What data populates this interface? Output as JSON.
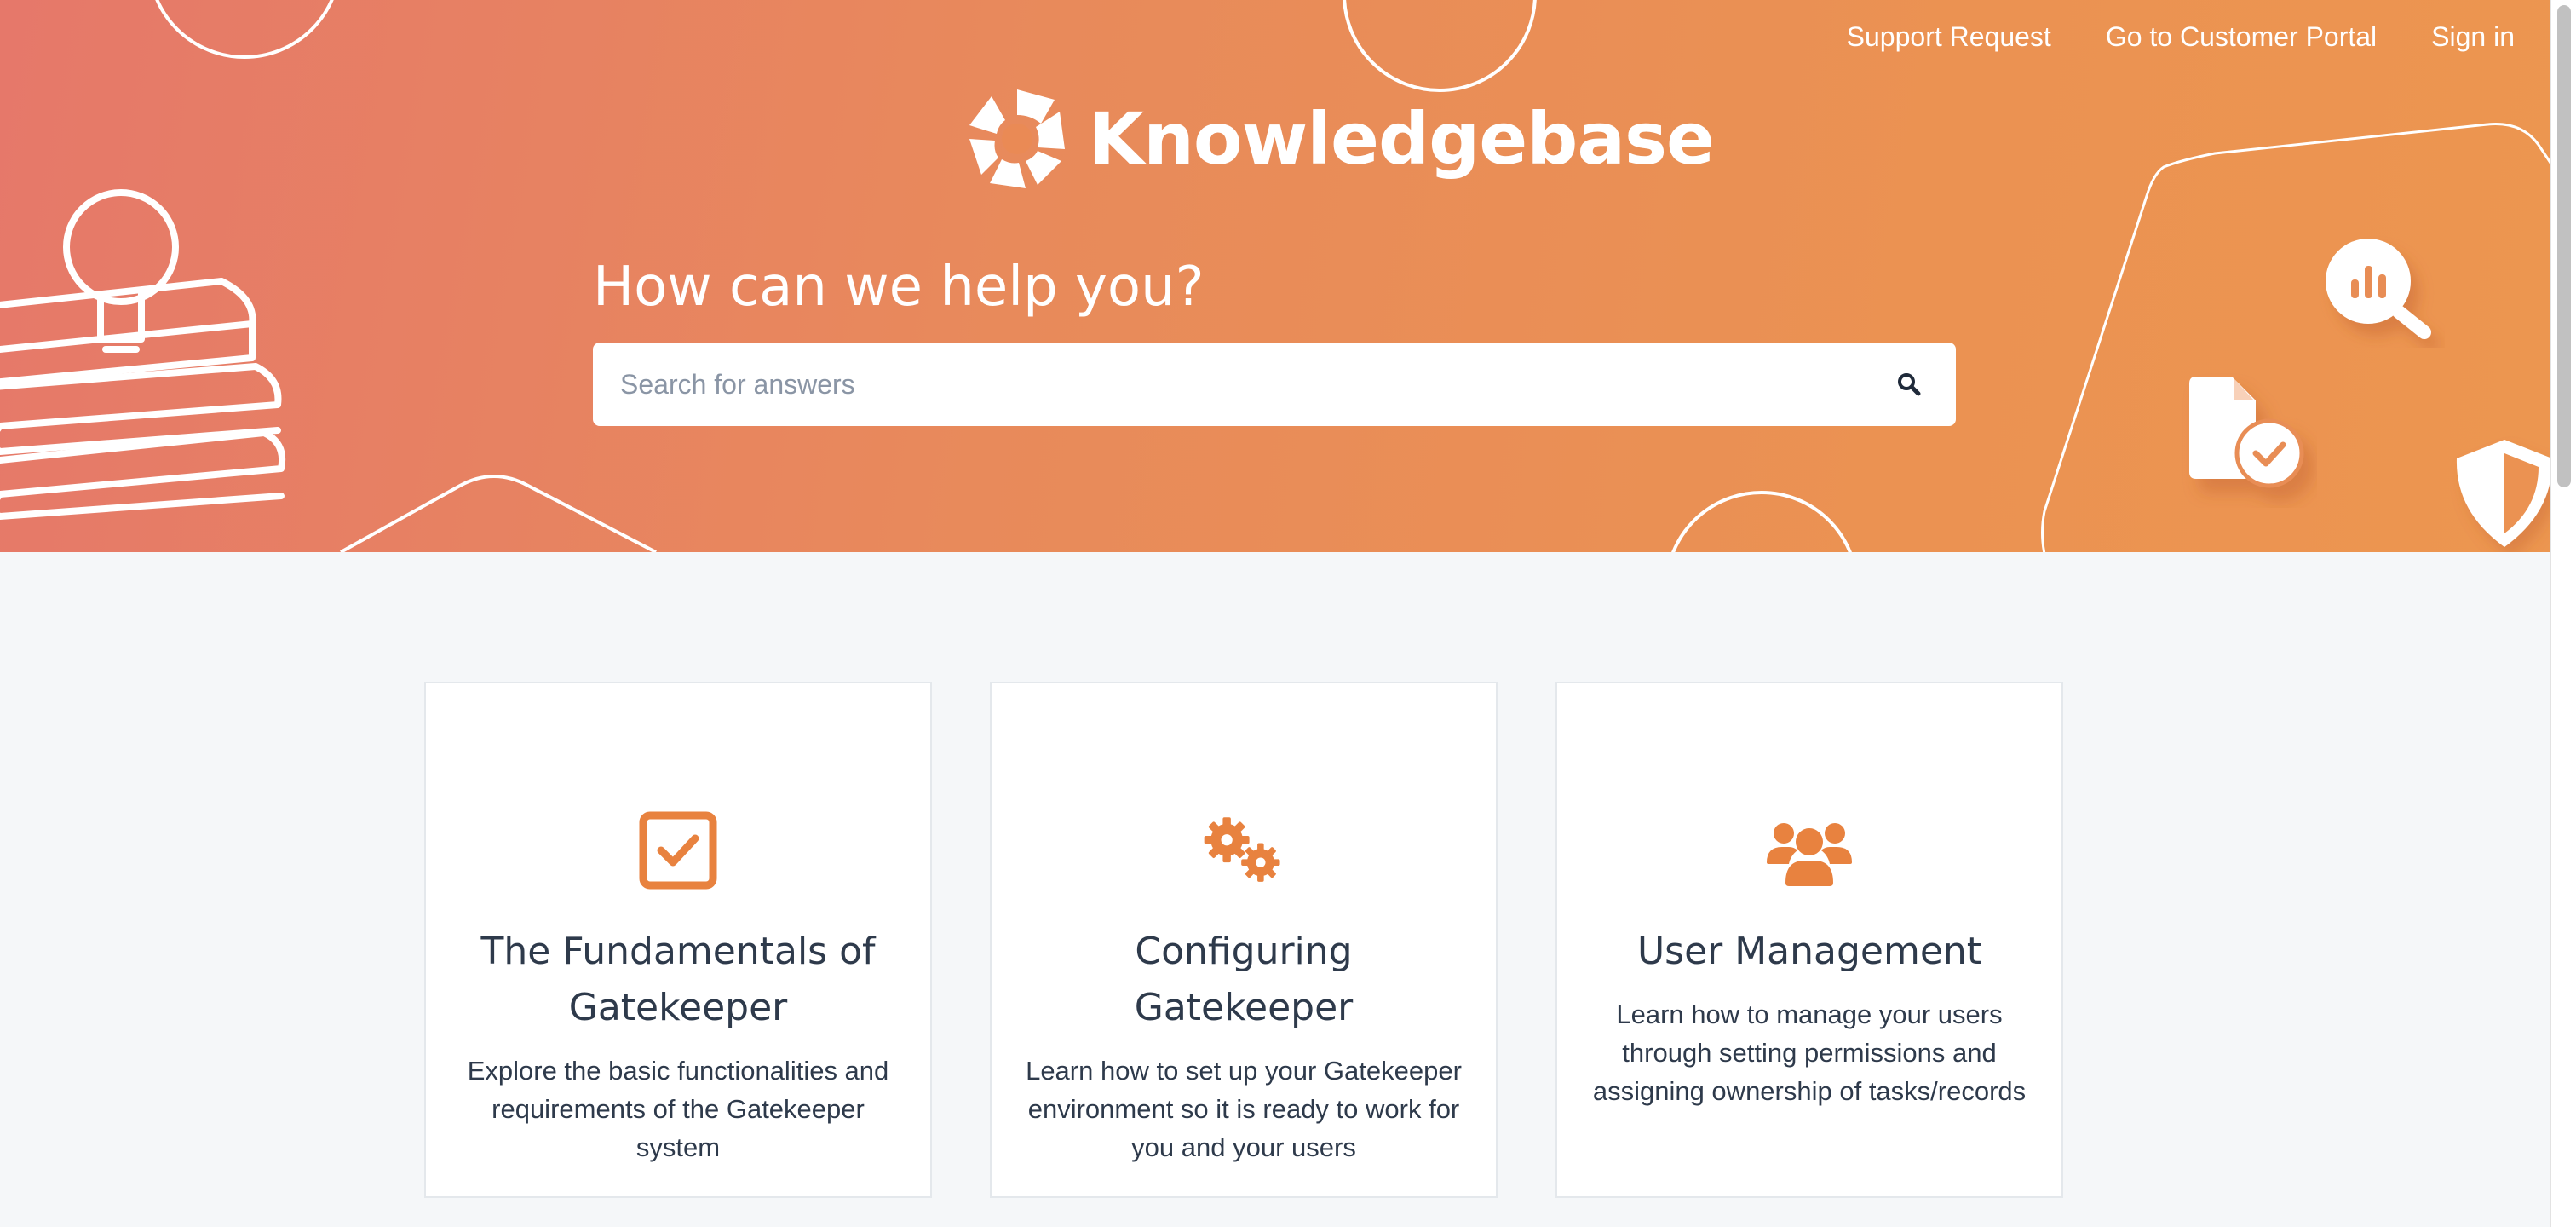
{
  "nav": {
    "support_request": "Support Request",
    "customer_portal": "Go to Customer Portal",
    "sign_in": "Sign in"
  },
  "brand": {
    "name": "Knowledgebase",
    "logo_icon": "gatekeeper-logo-icon"
  },
  "hero": {
    "headline": "How can we help you?",
    "search": {
      "placeholder": "Search for answers",
      "value": "",
      "icon": "search-icon"
    },
    "gradient_start": "#e6786a",
    "gradient_end": "#ec9650"
  },
  "cards": [
    {
      "icon": "checkbox-icon",
      "title": "The Fundamentals of Gatekeeper",
      "description": "Explore the basic functionalities and requirements of the Gatekeeper system"
    },
    {
      "icon": "gears-icon",
      "title": "Configuring Gatekeeper",
      "description": "Learn how to set up your Gatekeeper environment so it is ready to work for you and your users"
    },
    {
      "icon": "users-icon",
      "title": "User Management",
      "description": "Learn how to manage your users through setting permissions and assigning ownership of tasks/records"
    }
  ],
  "colors": {
    "accent": "#e8823f",
    "text": "#2e3a4b",
    "background": "#f5f7f9",
    "card_border": "#e4e8ec"
  }
}
